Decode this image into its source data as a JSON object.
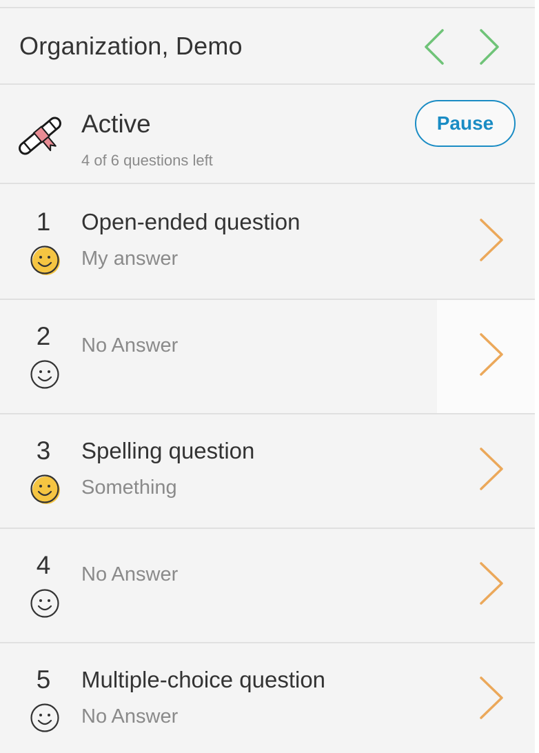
{
  "header": {
    "title": "Organization, Demo",
    "prev_icon": "chevron-left-icon",
    "next_icon": "chevron-right-icon",
    "nav_color": "#6fc378"
  },
  "status": {
    "icon": "diploma-icon",
    "title": "Active",
    "subtitle": "4 of 6 questions left",
    "pause_label": "Pause",
    "accent": "#1a8cc4"
  },
  "questions": [
    {
      "number": "1",
      "title": "Open-ended question",
      "answer": "My answer",
      "answered": true
    },
    {
      "number": "2",
      "title": "",
      "answer": "No Answer",
      "answered": false
    },
    {
      "number": "3",
      "title": "Spelling question",
      "answer": "Something",
      "answered": true
    },
    {
      "number": "4",
      "title": "",
      "answer": "No Answer",
      "answered": false
    },
    {
      "number": "5",
      "title": "Multiple-choice question",
      "answer": "No Answer",
      "answered": false
    }
  ],
  "colors": {
    "chevron": "#eba85a",
    "smiley_answered": "#f5c542",
    "smiley_outline": "#333333"
  }
}
